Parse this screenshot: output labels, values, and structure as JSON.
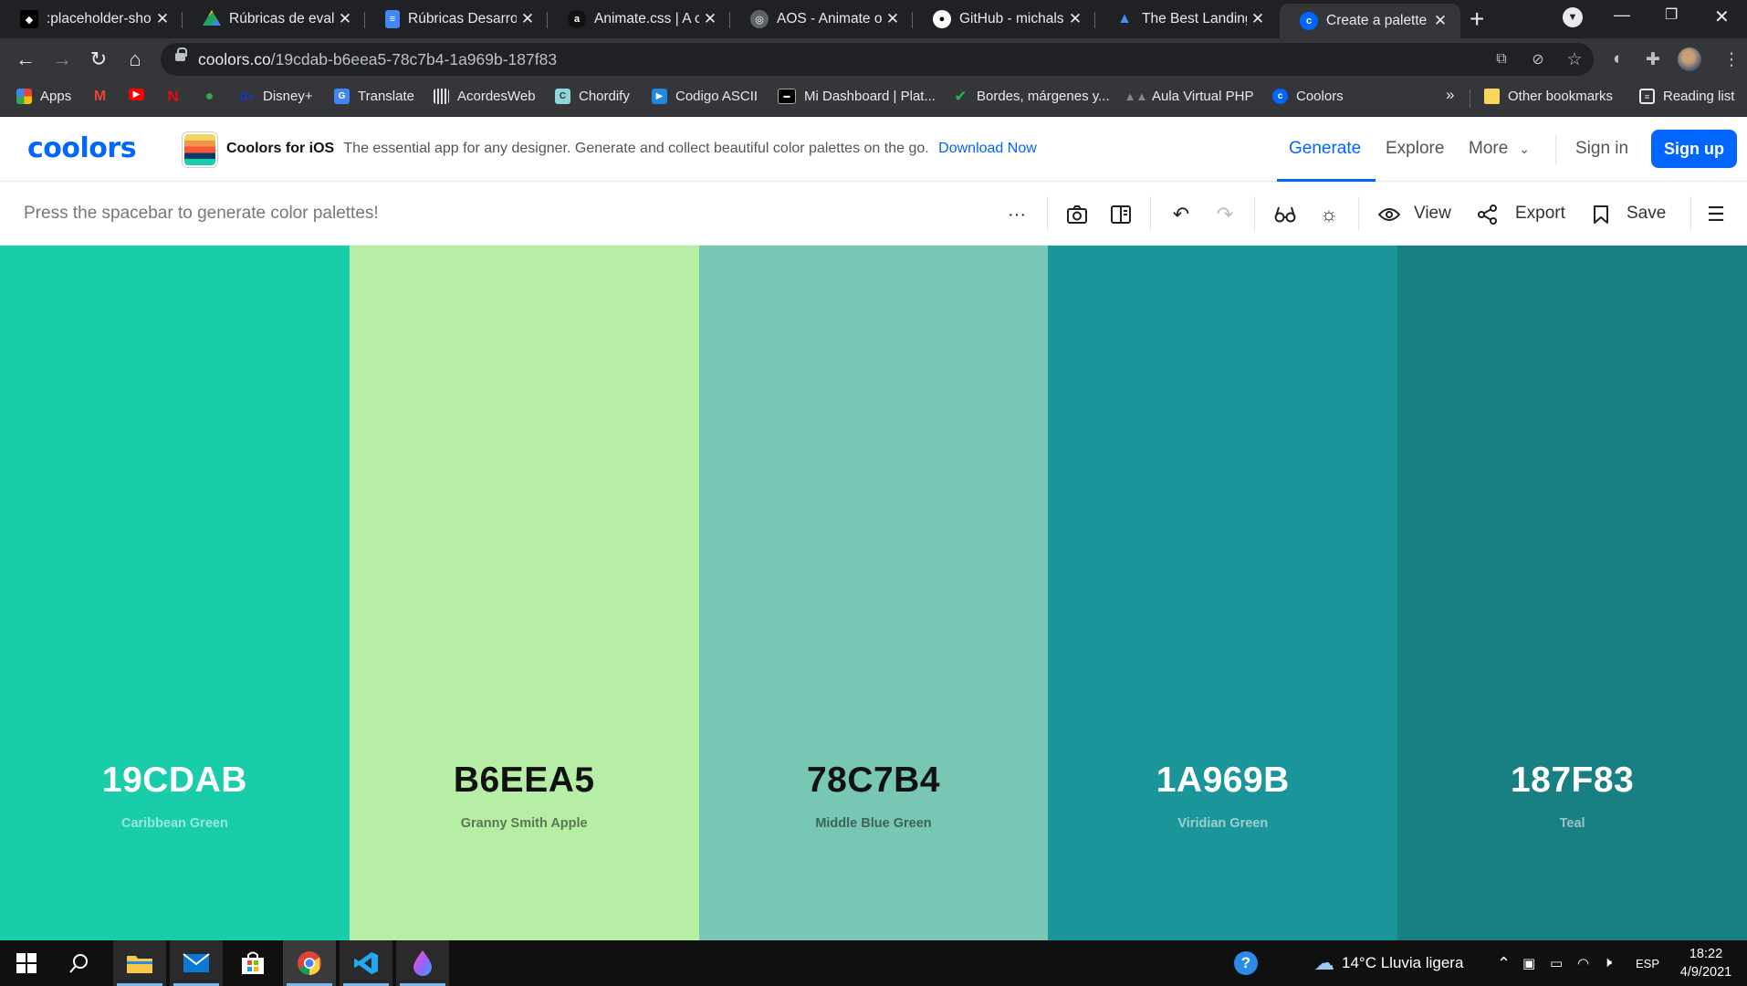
{
  "browser": {
    "tabs": [
      {
        "title": ":placeholder-shown",
        "icon": "placeholder-favicon-icon",
        "color": "#ffffff"
      },
      {
        "title": "Rúbricas de evaluación",
        "icon": "google-drive-icon",
        "color": "#1fa463"
      },
      {
        "title": "Rúbricas Desarrollo",
        "icon": "google-docs-icon",
        "color": "#4285f4"
      },
      {
        "title": "Animate.css | A cross",
        "icon": "animate-css-icon",
        "color": "#111111"
      },
      {
        "title": "AOS - Animate on scroll",
        "icon": "globe-icon",
        "color": "#5f6368"
      },
      {
        "title": "GitHub - michalsnik",
        "icon": "github-icon",
        "color": "#ffffff"
      },
      {
        "title": "The Best Landing Page",
        "icon": "landing-page-icon",
        "color": "#4a8af4"
      },
      {
        "title": "Create a palette - Coolors",
        "icon": "coolors-favicon-icon",
        "color": "#0066ff"
      }
    ],
    "url_host": "coolors.co",
    "url_path": "/19cdab-b6eea5-78c7b4-1a969b-187f83",
    "bookmarks": [
      {
        "label": "Apps",
        "icon": "apps-grid-icon",
        "color": "#ea4335"
      },
      {
        "label": "",
        "icon": "gmail-icon",
        "color": "#ea4335"
      },
      {
        "label": "",
        "icon": "youtube-icon",
        "color": "#ff0000"
      },
      {
        "label": "",
        "icon": "netflix-icon",
        "color": "#e50914"
      },
      {
        "label": "",
        "icon": "google-maps-icon",
        "color": "#34a853"
      },
      {
        "label": "Disney+",
        "icon": "disney-plus-icon",
        "color": "#113ccf"
      },
      {
        "label": "Translate",
        "icon": "google-translate-icon",
        "color": "#4285f4"
      },
      {
        "label": "AcordesWeb",
        "icon": "acordesweb-icon",
        "color": "#dddddd"
      },
      {
        "label": "Chordify",
        "icon": "chordify-icon",
        "color": "#22bbcc"
      },
      {
        "label": "Codigo ASCII",
        "icon": "codigo-ascii-icon",
        "color": "#1e88e5"
      },
      {
        "label": "Mi Dashboard | Plat...",
        "icon": "dashboard-icon",
        "color": "#000000"
      },
      {
        "label": "Bordes, márgenes y...",
        "icon": "checkmark-icon",
        "color": "#1db954"
      },
      {
        "label": "Aula Virtual PHP",
        "icon": "aula-virtual-icon",
        "color": "#888888"
      },
      {
        "label": "Coolors",
        "icon": "coolors-bookmark-icon",
        "color": "#0066ff"
      }
    ],
    "more_bookmarks": "»",
    "other_bookmarks": "Other bookmarks",
    "reading_list": "Reading list"
  },
  "coolors": {
    "logo": "coolors",
    "promo": {
      "title": "Coolors for iOS",
      "text": "The essential app for any designer. Generate and collect beautiful color palettes on the go.",
      "link": "Download Now"
    },
    "nav": {
      "generate": "Generate",
      "explore": "Explore",
      "more": "More",
      "sign_in": "Sign in",
      "sign_up": "Sign up"
    },
    "toolbar": {
      "hint": "Press the spacebar to generate color palettes!",
      "view": "View",
      "export": "Export",
      "save": "Save"
    },
    "accent": "#0066ff"
  },
  "palette": [
    {
      "hex": "19CDAB",
      "name": "Caribbean Green",
      "color": "#19cdab",
      "text_tone": "light"
    },
    {
      "hex": "B6EEA5",
      "name": "Granny Smith Apple",
      "color": "#b6eea5",
      "text_tone": "dark"
    },
    {
      "hex": "78C7B4",
      "name": "Middle Blue Green",
      "color": "#78c7b4",
      "text_tone": "dark"
    },
    {
      "hex": "1A969B",
      "name": "Viridian Green",
      "color": "#1a969b",
      "text_tone": "light"
    },
    {
      "hex": "187F83",
      "name": "Teal",
      "color": "#187f83",
      "text_tone": "light"
    }
  ],
  "taskbar": {
    "weather": "14°C  Lluvia ligera",
    "language": "ESP",
    "time": "18:22",
    "date": "4/9/2021"
  }
}
